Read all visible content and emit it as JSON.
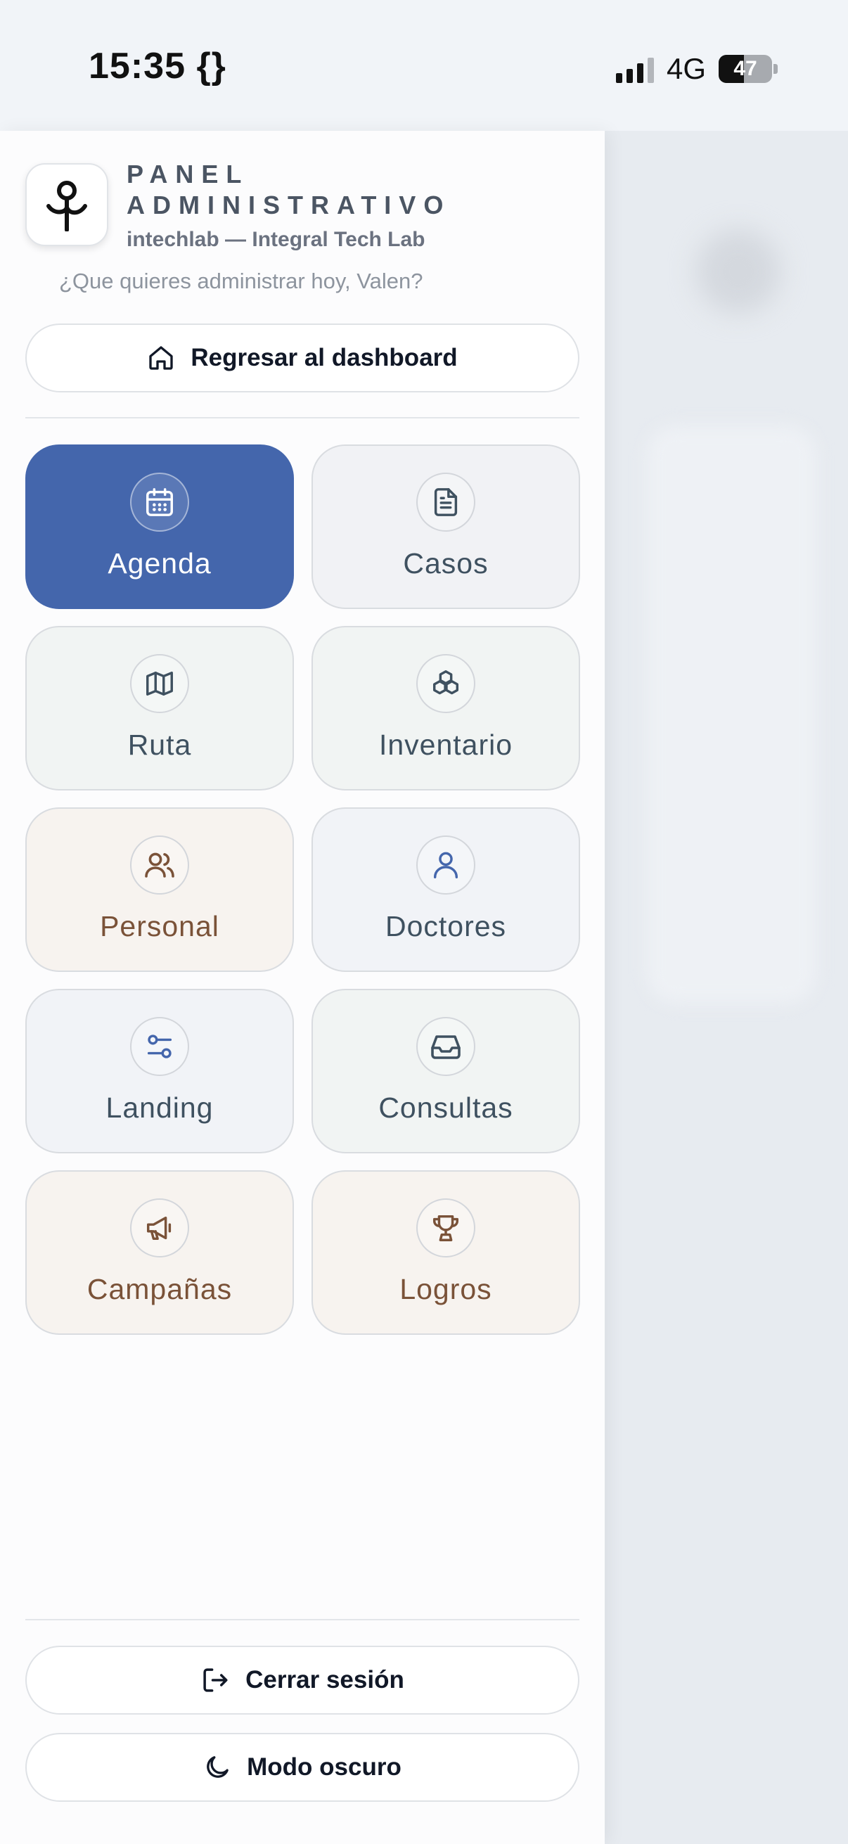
{
  "status_bar": {
    "time": "15:35 {}",
    "network": "4G",
    "battery": "47",
    "battery_level": 0.47
  },
  "drawer": {
    "title_line1": "PANEL",
    "title_line2": "ADMINISTRATIVO",
    "subtitle": "intechlab — Integral Tech Lab",
    "greeting": "¿Que quieres administrar hoy, Valen?",
    "dashboard_button": "Regresar al dashboard",
    "tiles": [
      {
        "label": "Agenda",
        "icon": "calendar-icon"
      },
      {
        "label": "Casos",
        "icon": "document-icon"
      },
      {
        "label": "Ruta",
        "icon": "map-icon"
      },
      {
        "label": "Inventario",
        "icon": "boxes-icon"
      },
      {
        "label": "Personal",
        "icon": "users-icon"
      },
      {
        "label": "Doctores",
        "icon": "user-icon"
      },
      {
        "label": "Landing",
        "icon": "sliders-icon"
      },
      {
        "label": "Consultas",
        "icon": "inbox-icon"
      },
      {
        "label": "Campañas",
        "icon": "megaphone-icon"
      },
      {
        "label": "Logros",
        "icon": "trophy-icon"
      }
    ],
    "active_tile": "Agenda",
    "logout_button": "Cerrar sesión",
    "dark_mode_button": "Modo oscuro"
  },
  "colors": {
    "accent": "#4466ac",
    "slate_text": "#3f5160",
    "warm_text": "#7a5238"
  }
}
